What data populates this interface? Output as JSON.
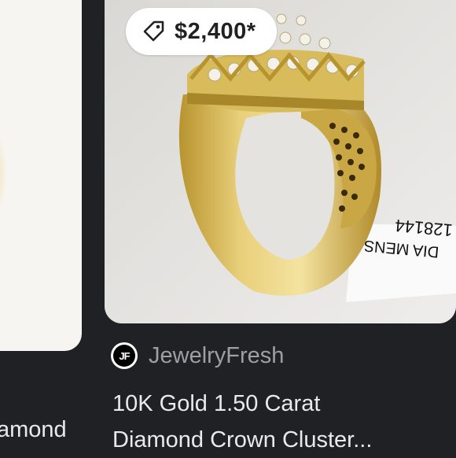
{
  "left_result": {
    "title_fragment": "amond"
  },
  "main_result": {
    "price_chip": {
      "icon": "price-tag-icon",
      "price": "$2,400*"
    },
    "image_tag": {
      "line1": "DIA MENS",
      "line2": "128144"
    },
    "source": {
      "logo_text": "JF",
      "name": "JewelryFresh"
    },
    "title_line1": "10K Gold 1.50 Carat",
    "title_line2": "Diamond Crown Cluster..."
  },
  "colors": {
    "background": "#202124",
    "title_text": "#e8eaed",
    "source_text": "#9aa0a6",
    "chip_bg": "#ffffff"
  }
}
